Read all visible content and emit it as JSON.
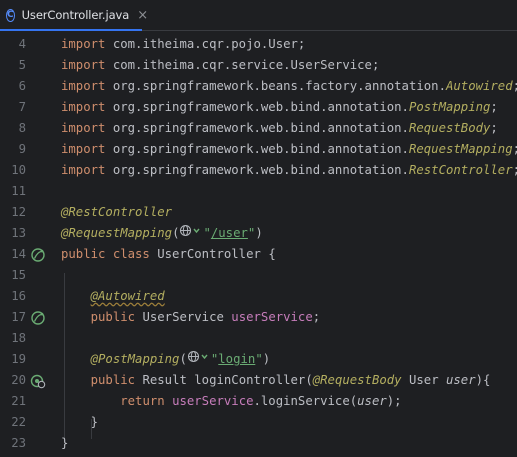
{
  "tab": {
    "icon": "C",
    "label": "UserController.java",
    "close": "×"
  },
  "lines": [
    {
      "n": "4",
      "tokens": [
        [
          "kw",
          "import"
        ],
        [
          "cls",
          " com.itheima.cqr.pojo.User;"
        ]
      ]
    },
    {
      "n": "5",
      "tokens": [
        [
          "kw",
          "import"
        ],
        [
          "cls",
          " com.itheima.cqr.service.UserService;"
        ]
      ]
    },
    {
      "n": "6",
      "tokens": [
        [
          "kw",
          "import"
        ],
        [
          "cls",
          " org.springframework.beans.factory.annotation."
        ],
        [
          "ann-i",
          "Autowired"
        ],
        [
          "cls",
          ";"
        ]
      ]
    },
    {
      "n": "7",
      "tokens": [
        [
          "kw",
          "import"
        ],
        [
          "cls",
          " org.springframework.web.bind.annotation."
        ],
        [
          "ann-i",
          "PostMapping"
        ],
        [
          "cls",
          ";"
        ]
      ]
    },
    {
      "n": "8",
      "tokens": [
        [
          "kw",
          "import"
        ],
        [
          "cls",
          " org.springframework.web.bind.annotation."
        ],
        [
          "ann-i",
          "RequestBody"
        ],
        [
          "cls",
          ";"
        ]
      ]
    },
    {
      "n": "9",
      "tokens": [
        [
          "kw",
          "import"
        ],
        [
          "cls",
          " org.springframework.web.bind.annotation."
        ],
        [
          "ann-i",
          "RequestMapping"
        ],
        [
          "cls",
          ";"
        ]
      ]
    },
    {
      "n": "10",
      "tokens": [
        [
          "kw",
          "import"
        ],
        [
          "cls",
          " org.springframework.web.bind.annotation."
        ],
        [
          "ann-i",
          "RestController"
        ],
        [
          "cls",
          ";"
        ]
      ]
    },
    {
      "n": "11",
      "tokens": []
    },
    {
      "n": "12",
      "tokens": [
        [
          "ann-i",
          "@RestController"
        ]
      ]
    },
    {
      "n": "13",
      "tokens": [
        [
          "ann-i",
          "@RequestMapping"
        ],
        [
          "cls",
          "("
        ],
        [
          "globe",
          ""
        ],
        [
          "str",
          "\"/user\""
        ],
        [
          "cls",
          ")"
        ]
      ]
    },
    {
      "n": "14",
      "tokens": [
        [
          "kw",
          "public class "
        ],
        [
          "cls",
          "UserController "
        ],
        [
          "brace",
          "{"
        ]
      ]
    },
    {
      "n": "15",
      "tokens": []
    },
    {
      "n": "16",
      "tokens": [
        [
          "cls",
          "    "
        ],
        [
          "ann-i-warn",
          "@Autowired"
        ]
      ]
    },
    {
      "n": "17",
      "tokens": [
        [
          "cls",
          "    "
        ],
        [
          "kw",
          "public "
        ],
        [
          "cls",
          "UserService "
        ],
        [
          "field",
          "userService"
        ],
        [
          "cls",
          ";"
        ]
      ]
    },
    {
      "n": "18",
      "tokens": []
    },
    {
      "n": "19",
      "tokens": [
        [
          "cls",
          "    "
        ],
        [
          "ann-i",
          "@PostMapping"
        ],
        [
          "cls",
          "("
        ],
        [
          "globe",
          ""
        ],
        [
          "str",
          "\"login\""
        ],
        [
          "cls",
          ")"
        ]
      ]
    },
    {
      "n": "20",
      "tokens": [
        [
          "cls",
          "    "
        ],
        [
          "kw",
          "public "
        ],
        [
          "cls",
          "Result loginController("
        ],
        [
          "ann-i",
          "@RequestBody"
        ],
        [
          "cls",
          " User "
        ],
        [
          "param",
          "user"
        ],
        [
          "cls",
          ")"
        ],
        [
          "brace",
          "{"
        ]
      ]
    },
    {
      "n": "21",
      "tokens": [
        [
          "cls",
          "        "
        ],
        [
          "kw",
          "return "
        ],
        [
          "field",
          "userService"
        ],
        [
          "cls",
          ".loginService("
        ],
        [
          "param",
          "user"
        ],
        [
          "cls",
          ");"
        ]
      ]
    },
    {
      "n": "22",
      "tokens": [
        [
          "cls",
          "    "
        ],
        [
          "brace",
          "}"
        ]
      ]
    },
    {
      "n": "23",
      "tokens": [
        [
          "brace",
          "}"
        ]
      ]
    }
  ],
  "markers": {
    "14": "bean-class-icon",
    "17": "autowired-bean-icon",
    "20": "endpoint-icon"
  },
  "colors": {
    "background": "#1e1f22",
    "keyword": "#cf8e6d",
    "annotation": "#b3ae60",
    "string": "#6aab73",
    "field": "#c77dbb",
    "line_number": "#6f737a",
    "tab_accent": "#3574f0"
  }
}
